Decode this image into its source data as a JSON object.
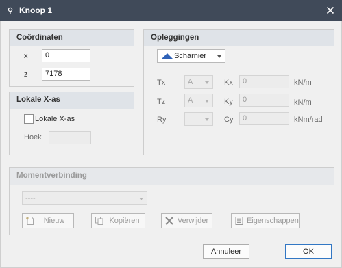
{
  "window": {
    "title": "Knoop 1"
  },
  "coordinates": {
    "title": "Coördinaten",
    "x_label": "x",
    "x_value": "0",
    "z_label": "z",
    "z_value": "7178"
  },
  "local_axis": {
    "title": "Lokale X-as",
    "checkbox_label": "Lokale X-as",
    "angle_label": "Hoek",
    "angle_value": ""
  },
  "supports": {
    "title": "Opleggingen",
    "type_selected": "Scharnier",
    "rows": [
      {
        "dof": "Tx",
        "option": "A",
        "stiffness_label": "Kx",
        "stiffness_value": "0",
        "unit": "kN/m"
      },
      {
        "dof": "Tz",
        "option": "A",
        "stiffness_label": "Ky",
        "stiffness_value": "0",
        "unit": "kN/m"
      },
      {
        "dof": "Ry",
        "option": "",
        "stiffness_label": "Cy",
        "stiffness_value": "0",
        "unit": "kNm/rad"
      }
    ]
  },
  "moment_connection": {
    "title": "Momentverbinding",
    "selected": "----",
    "buttons": {
      "new": "Nieuw",
      "copy": "Kopiëren",
      "delete": "Verwijder",
      "properties": "Eigenschappen"
    }
  },
  "footer": {
    "cancel": "Annuleer",
    "ok": "OK"
  },
  "colors": {
    "titlebar": "#404a59",
    "panel_header": "#dfe3e8",
    "accent": "#2f62b8",
    "ok_border": "#3277c4"
  }
}
